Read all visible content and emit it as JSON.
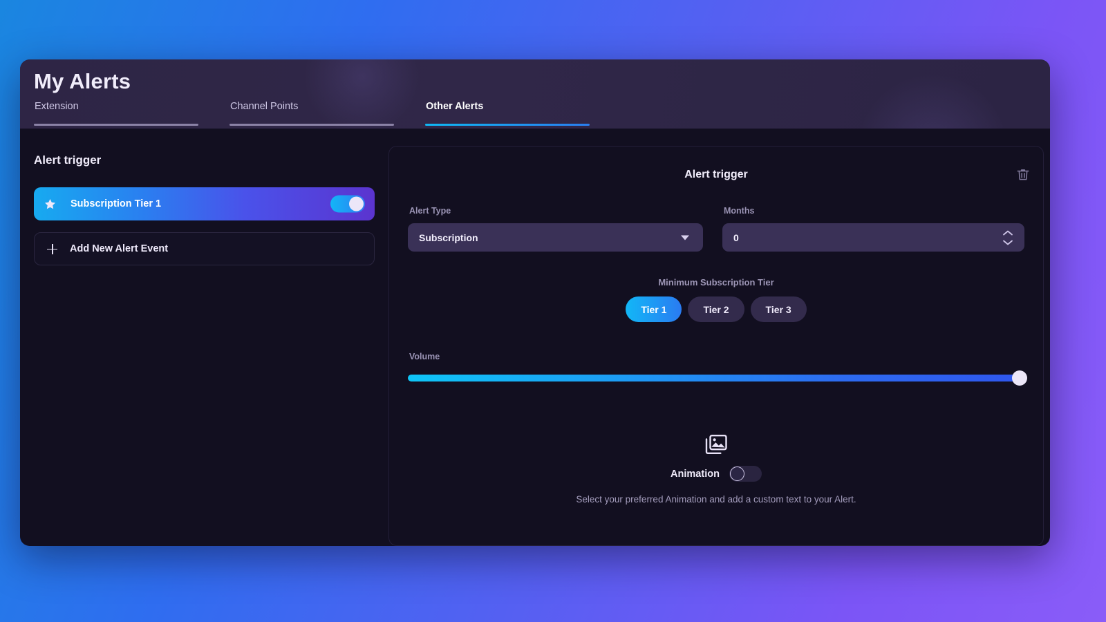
{
  "header": {
    "title": "My Alerts",
    "tabs": [
      {
        "label": "Extension",
        "active": false
      },
      {
        "label": "Channel Points",
        "active": false
      },
      {
        "label": "Other Alerts",
        "active": true
      }
    ]
  },
  "sidebar": {
    "heading": "Alert trigger",
    "alert_card": {
      "label": "Subscription Tier 1",
      "icon": "star-icon",
      "toggle_state": "on"
    },
    "add_event": {
      "label": "Add New Alert Event",
      "icon": "plus-icon"
    }
  },
  "panel": {
    "title": "Alert trigger",
    "delete_icon": "trash-icon",
    "alert_type": {
      "label": "Alert Type",
      "value": "Subscription",
      "options": [
        "Subscription"
      ]
    },
    "months": {
      "label": "Months",
      "value": "0"
    },
    "tier": {
      "label": "Minimum Subscription Tier",
      "options": [
        {
          "label": "Tier 1",
          "active": true
        },
        {
          "label": "Tier 2",
          "active": false
        },
        {
          "label": "Tier 3",
          "active": false
        }
      ]
    },
    "volume": {
      "label": "Volume",
      "value": 100
    },
    "animation": {
      "icon": "image-icon",
      "label": "Animation",
      "toggle_state": "off",
      "hint": "Select your preferred Animation and add a custom text to your Alert."
    }
  },
  "colors": {
    "accent_cyan": "#12b7f7",
    "accent_blue": "#2a7bf1",
    "accent_purple": "#5b34cf",
    "panel_bg": "#120f20",
    "header_bg": "#2e2545",
    "field_bg": "#3a3157"
  }
}
